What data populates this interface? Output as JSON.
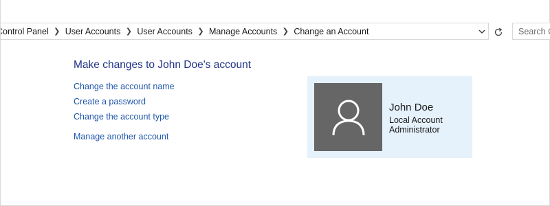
{
  "address_bar": {
    "crumbs": [
      "Control Panel",
      "User Accounts",
      "User Accounts",
      "Manage Accounts",
      "Change an Account"
    ],
    "separator_icon": "chevron-right-icon",
    "dropdown_icon": "chevron-down-icon"
  },
  "refresh_icon": "refresh-icon",
  "search": {
    "placeholder": "Search Control Panel"
  },
  "heading": "Make changes to John Doe's account",
  "tasks": {
    "change_name": "Change the account name",
    "create_password": "Create a password",
    "change_type": "Change the account type",
    "manage_another": "Manage another account"
  },
  "account": {
    "name": "John Doe",
    "type": "Local Account",
    "role": "Administrator",
    "avatar_icon": "user-icon"
  },
  "colors": {
    "link": "#1e55aa",
    "heading": "#1e3287",
    "tile_bg": "#e5f1fb",
    "avatar_bg": "#666666"
  }
}
